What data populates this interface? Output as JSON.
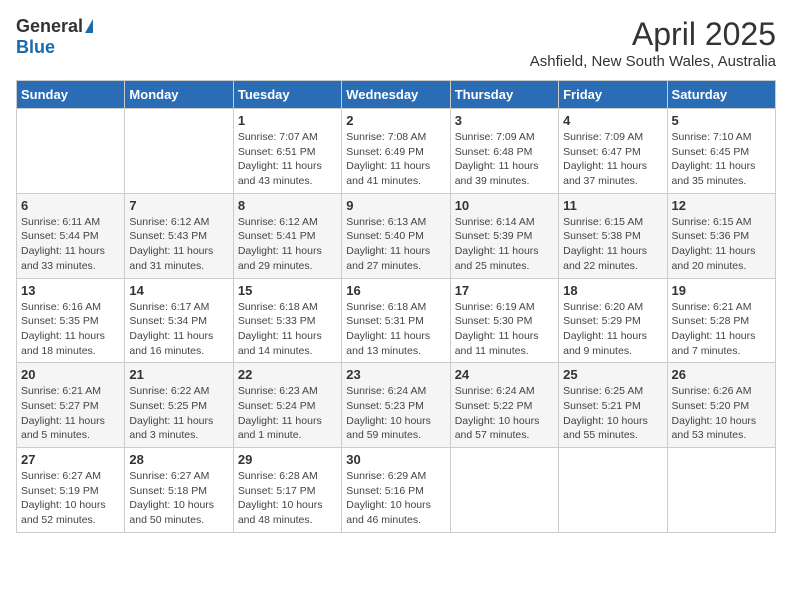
{
  "header": {
    "logo_general": "General",
    "logo_blue": "Blue",
    "month_year": "April 2025",
    "location": "Ashfield, New South Wales, Australia"
  },
  "days_of_week": [
    "Sunday",
    "Monday",
    "Tuesday",
    "Wednesday",
    "Thursday",
    "Friday",
    "Saturday"
  ],
  "weeks": [
    [
      {
        "day": "",
        "info": ""
      },
      {
        "day": "",
        "info": ""
      },
      {
        "day": "1",
        "info": "Sunrise: 7:07 AM\nSunset: 6:51 PM\nDaylight: 11 hours and 43 minutes."
      },
      {
        "day": "2",
        "info": "Sunrise: 7:08 AM\nSunset: 6:49 PM\nDaylight: 11 hours and 41 minutes."
      },
      {
        "day": "3",
        "info": "Sunrise: 7:09 AM\nSunset: 6:48 PM\nDaylight: 11 hours and 39 minutes."
      },
      {
        "day": "4",
        "info": "Sunrise: 7:09 AM\nSunset: 6:47 PM\nDaylight: 11 hours and 37 minutes."
      },
      {
        "day": "5",
        "info": "Sunrise: 7:10 AM\nSunset: 6:45 PM\nDaylight: 11 hours and 35 minutes."
      }
    ],
    [
      {
        "day": "6",
        "info": "Sunrise: 6:11 AM\nSunset: 5:44 PM\nDaylight: 11 hours and 33 minutes."
      },
      {
        "day": "7",
        "info": "Sunrise: 6:12 AM\nSunset: 5:43 PM\nDaylight: 11 hours and 31 minutes."
      },
      {
        "day": "8",
        "info": "Sunrise: 6:12 AM\nSunset: 5:41 PM\nDaylight: 11 hours and 29 minutes."
      },
      {
        "day": "9",
        "info": "Sunrise: 6:13 AM\nSunset: 5:40 PM\nDaylight: 11 hours and 27 minutes."
      },
      {
        "day": "10",
        "info": "Sunrise: 6:14 AM\nSunset: 5:39 PM\nDaylight: 11 hours and 25 minutes."
      },
      {
        "day": "11",
        "info": "Sunrise: 6:15 AM\nSunset: 5:38 PM\nDaylight: 11 hours and 22 minutes."
      },
      {
        "day": "12",
        "info": "Sunrise: 6:15 AM\nSunset: 5:36 PM\nDaylight: 11 hours and 20 minutes."
      }
    ],
    [
      {
        "day": "13",
        "info": "Sunrise: 6:16 AM\nSunset: 5:35 PM\nDaylight: 11 hours and 18 minutes."
      },
      {
        "day": "14",
        "info": "Sunrise: 6:17 AM\nSunset: 5:34 PM\nDaylight: 11 hours and 16 minutes."
      },
      {
        "day": "15",
        "info": "Sunrise: 6:18 AM\nSunset: 5:33 PM\nDaylight: 11 hours and 14 minutes."
      },
      {
        "day": "16",
        "info": "Sunrise: 6:18 AM\nSunset: 5:31 PM\nDaylight: 11 hours and 13 minutes."
      },
      {
        "day": "17",
        "info": "Sunrise: 6:19 AM\nSunset: 5:30 PM\nDaylight: 11 hours and 11 minutes."
      },
      {
        "day": "18",
        "info": "Sunrise: 6:20 AM\nSunset: 5:29 PM\nDaylight: 11 hours and 9 minutes."
      },
      {
        "day": "19",
        "info": "Sunrise: 6:21 AM\nSunset: 5:28 PM\nDaylight: 11 hours and 7 minutes."
      }
    ],
    [
      {
        "day": "20",
        "info": "Sunrise: 6:21 AM\nSunset: 5:27 PM\nDaylight: 11 hours and 5 minutes."
      },
      {
        "day": "21",
        "info": "Sunrise: 6:22 AM\nSunset: 5:25 PM\nDaylight: 11 hours and 3 minutes."
      },
      {
        "day": "22",
        "info": "Sunrise: 6:23 AM\nSunset: 5:24 PM\nDaylight: 11 hours and 1 minute."
      },
      {
        "day": "23",
        "info": "Sunrise: 6:24 AM\nSunset: 5:23 PM\nDaylight: 10 hours and 59 minutes."
      },
      {
        "day": "24",
        "info": "Sunrise: 6:24 AM\nSunset: 5:22 PM\nDaylight: 10 hours and 57 minutes."
      },
      {
        "day": "25",
        "info": "Sunrise: 6:25 AM\nSunset: 5:21 PM\nDaylight: 10 hours and 55 minutes."
      },
      {
        "day": "26",
        "info": "Sunrise: 6:26 AM\nSunset: 5:20 PM\nDaylight: 10 hours and 53 minutes."
      }
    ],
    [
      {
        "day": "27",
        "info": "Sunrise: 6:27 AM\nSunset: 5:19 PM\nDaylight: 10 hours and 52 minutes."
      },
      {
        "day": "28",
        "info": "Sunrise: 6:27 AM\nSunset: 5:18 PM\nDaylight: 10 hours and 50 minutes."
      },
      {
        "day": "29",
        "info": "Sunrise: 6:28 AM\nSunset: 5:17 PM\nDaylight: 10 hours and 48 minutes."
      },
      {
        "day": "30",
        "info": "Sunrise: 6:29 AM\nSunset: 5:16 PM\nDaylight: 10 hours and 46 minutes."
      },
      {
        "day": "",
        "info": ""
      },
      {
        "day": "",
        "info": ""
      },
      {
        "day": "",
        "info": ""
      }
    ]
  ]
}
